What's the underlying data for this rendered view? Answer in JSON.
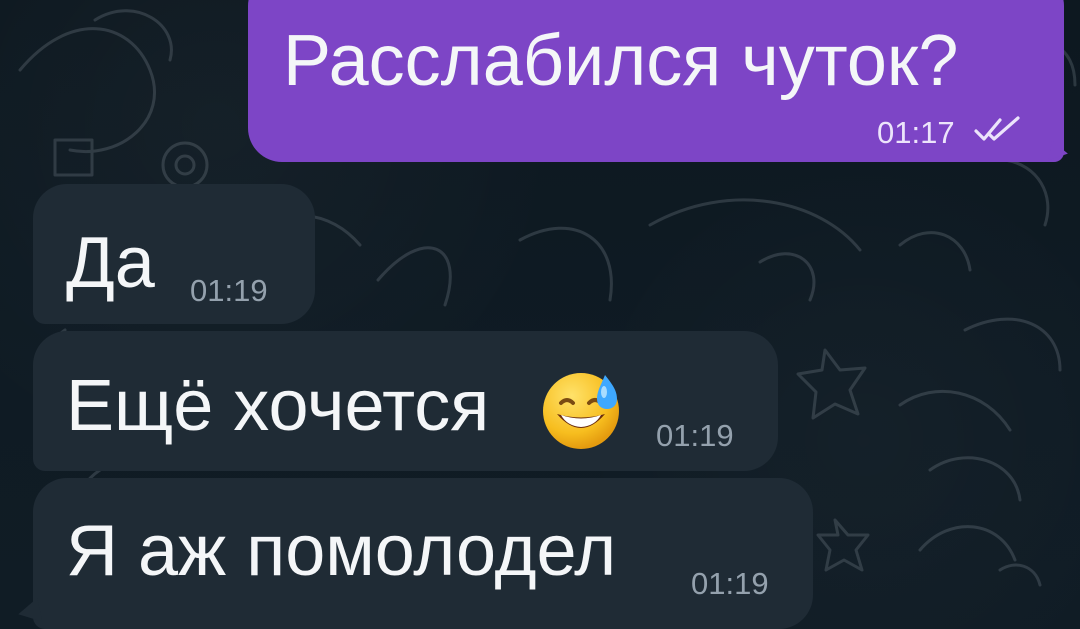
{
  "chat": {
    "messages": [
      {
        "direction": "outgoing",
        "text": "Расслабился чуток?",
        "time": "01:17",
        "status_icon": "double-check-icon"
      },
      {
        "direction": "incoming",
        "text": "Да",
        "time": "01:19"
      },
      {
        "direction": "incoming",
        "text": "Ещё хочется",
        "time": "01:19",
        "emoji": "grinning-face-with-sweat-icon"
      },
      {
        "direction": "incoming",
        "text": "Я аж помолодел",
        "time": "01:19"
      }
    ]
  },
  "theme": {
    "background": "#0f1a22",
    "outgoing_bubble": "#7d45c6",
    "incoming_bubble": "#1f2b35",
    "text": "#f4f6f8",
    "timestamp": "#94a1ad"
  }
}
